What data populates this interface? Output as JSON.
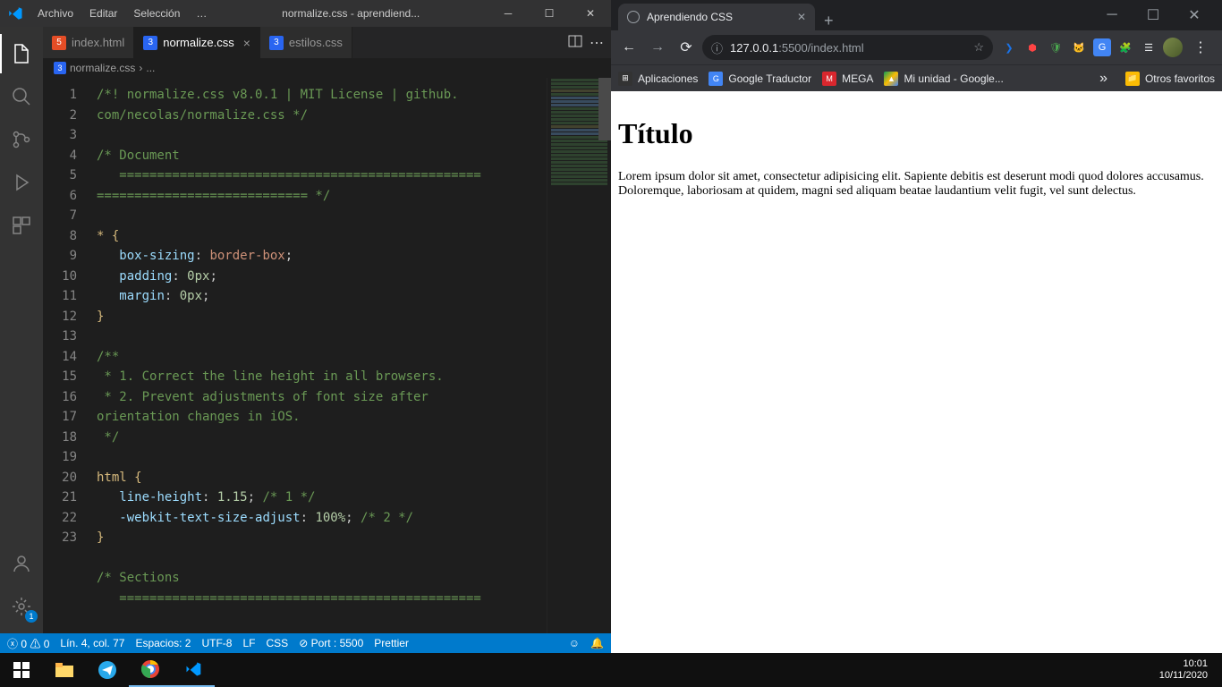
{
  "vscode": {
    "menu": [
      "Archivo",
      "Editar",
      "Selección",
      "…"
    ],
    "title": "normalize.css - aprendiend...",
    "tabs": [
      {
        "label": "index.html",
        "active": false,
        "type": "html"
      },
      {
        "label": "normalize.css",
        "active": true,
        "type": "css"
      },
      {
        "label": "estilos.css",
        "active": false,
        "type": "css"
      }
    ],
    "breadcrumb": {
      "file": "normalize.css",
      "sep": "›",
      "more": "..."
    },
    "gutter": [
      "1",
      "2",
      "3",
      "4",
      "",
      "5",
      "6",
      "7",
      "8",
      "9",
      "10",
      "11",
      "12",
      "13",
      "14",
      "",
      "15",
      "16",
      "17",
      "18",
      "19",
      "20",
      "21",
      "22",
      "23"
    ],
    "code": {
      "l1": "/*! normalize.css v8.0.1 | MIT License | github.",
      "l1b": "com/necolas/normalize.css */",
      "l3": "/* Document",
      "l4a": "   ================================================",
      "l4b": "============================ */",
      "l6": "* {",
      "l7a": "box-sizing",
      "l7b": ": ",
      "l7c": "border-box",
      "l7d": ";",
      "l8a": "padding",
      "l8b": ": ",
      "l8c": "0px",
      "l8d": ";",
      "l9a": "margin",
      "l9b": ": ",
      "l9c": "0px",
      "l9d": ";",
      "l10": "}",
      "l12": "/**",
      "l13": " * 1. Correct the line height in all browsers.",
      "l14": " * 2. Prevent adjustments of font size after ",
      "l14b": "orientation changes in iOS.",
      "l15": " */",
      "l17": "html {",
      "l18a": "line-height",
      "l18b": ": ",
      "l18c": "1.15",
      "l18d": "; ",
      "l18e": "/* 1 */",
      "l19a": "-webkit-text-size-adjust",
      "l19b": ": ",
      "l19c": "100%",
      "l19d": "; ",
      "l19e": "/* 2 */",
      "l20": "}",
      "l22": "/* Sections",
      "l23": "   ================================================"
    },
    "status": {
      "errors": "0",
      "warnings": "0",
      "ln": "Lín. 4, col. 77",
      "spaces": "Espacios: 2",
      "enc": "UTF-8",
      "eol": "LF",
      "lang": "CSS",
      "port": "Port : 5500",
      "prettier": "Prettier"
    },
    "settings_badge": "1"
  },
  "chrome": {
    "tab_title": "Aprendiendo CSS",
    "url_host": "127.0.0.1",
    "url_port": ":5500",
    "url_path": "/index.html",
    "bookmarks": [
      {
        "label": "Aplicaciones",
        "color": "#4285f4"
      },
      {
        "label": "Google Traductor",
        "color": "#4285f4"
      },
      {
        "label": "MEGA",
        "color": "#d9272e"
      },
      {
        "label": "Mi unidad - Google...",
        "color": "#0f9d58"
      }
    ],
    "other_bookmarks": "Otros favoritos",
    "content": {
      "heading": "Título",
      "paragraph": "Lorem ipsum dolor sit amet, consectetur adipisicing elit. Sapiente debitis est deserunt modi quod dolores accusamus. Doloremque, laboriosam at quidem, magni sed aliquam beatae laudantium velit fugit, vel sunt delectus."
    }
  },
  "taskbar": {
    "time": "10:01",
    "date": "10/11/2020"
  }
}
